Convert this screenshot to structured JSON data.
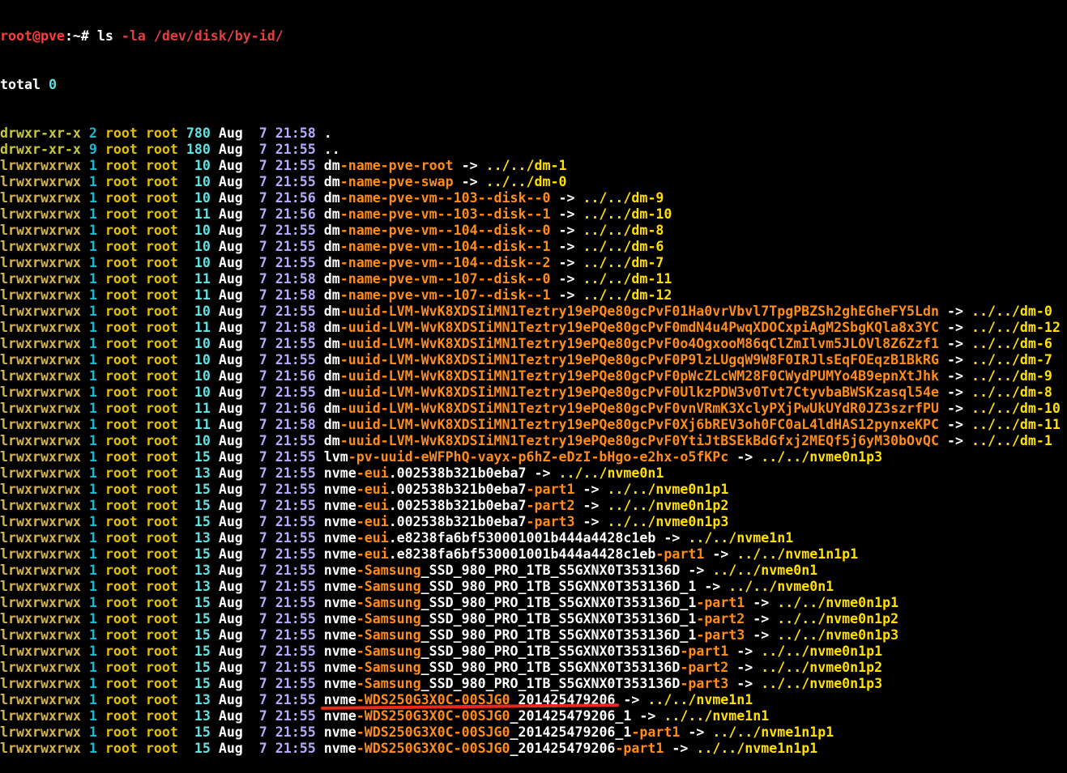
{
  "colors": {
    "background": "#000000",
    "default_text": "#ffffff",
    "prompt_user": "#ff3b3b",
    "perm_dir": "#c8c840",
    "perm_link": "#d4b44a",
    "links_count": "#22b8d0",
    "owner": "#e0c000",
    "group": "#e0c000",
    "size": "#60e0e0",
    "month": "#ffffff",
    "day": "#b8a9ff",
    "time": "#b8a9ff",
    "name_white": "#ffffff",
    "name_orange": "#ff8c1a",
    "arrow": "#ffffff",
    "target": "#ffe000",
    "annotation": "#e8271f"
  },
  "terminal": {
    "prompt": {
      "user_host": "root@pve",
      "suffix": ":~# ",
      "command": "ls",
      "args": " -la /dev/disk/by-id/"
    },
    "total_line": {
      "label": "total ",
      "value": "0"
    },
    "entries": [
      {
        "perm": "drwxr-xr-x",
        "links": "2",
        "owner": "root",
        "group": "root",
        "size": "780",
        "month": "Aug",
        "day": " 7",
        "time": "21:58",
        "name": [
          [
            "w",
            "."
          ]
        ],
        "target": ""
      },
      {
        "perm": "drwxr-xr-x",
        "links": "9",
        "owner": "root",
        "group": "root",
        "size": "180",
        "month": "Aug",
        "day": " 7",
        "time": "21:55",
        "name": [
          [
            "w",
            ".."
          ]
        ],
        "target": ""
      },
      {
        "perm": "lrwxrwxrwx",
        "links": "1",
        "owner": "root",
        "group": "root",
        "size": " 10",
        "month": "Aug",
        "day": " 7",
        "time": "21:55",
        "name": [
          [
            "w",
            "dm"
          ],
          [
            "o",
            "-name-pve-root"
          ]
        ],
        "target": "../../dm-1"
      },
      {
        "perm": "lrwxrwxrwx",
        "links": "1",
        "owner": "root",
        "group": "root",
        "size": " 10",
        "month": "Aug",
        "day": " 7",
        "time": "21:55",
        "name": [
          [
            "w",
            "dm"
          ],
          [
            "o",
            "-name-pve-swap"
          ]
        ],
        "target": "../../dm-0"
      },
      {
        "perm": "lrwxrwxrwx",
        "links": "1",
        "owner": "root",
        "group": "root",
        "size": " 10",
        "month": "Aug",
        "day": " 7",
        "time": "21:56",
        "name": [
          [
            "w",
            "dm"
          ],
          [
            "o",
            "-name-pve-vm--103--disk--0"
          ]
        ],
        "target": "../../dm-9"
      },
      {
        "perm": "lrwxrwxrwx",
        "links": "1",
        "owner": "root",
        "group": "root",
        "size": " 11",
        "month": "Aug",
        "day": " 7",
        "time": "21:56",
        "name": [
          [
            "w",
            "dm"
          ],
          [
            "o",
            "-name-pve-vm--103--disk--1"
          ]
        ],
        "target": "../../dm-10"
      },
      {
        "perm": "lrwxrwxrwx",
        "links": "1",
        "owner": "root",
        "group": "root",
        "size": " 10",
        "month": "Aug",
        "day": " 7",
        "time": "21:55",
        "name": [
          [
            "w",
            "dm"
          ],
          [
            "o",
            "-name-pve-vm--104--disk--0"
          ]
        ],
        "target": "../../dm-8"
      },
      {
        "perm": "lrwxrwxrwx",
        "links": "1",
        "owner": "root",
        "group": "root",
        "size": " 10",
        "month": "Aug",
        "day": " 7",
        "time": "21:55",
        "name": [
          [
            "w",
            "dm"
          ],
          [
            "o",
            "-name-pve-vm--104--disk--1"
          ]
        ],
        "target": "../../dm-6"
      },
      {
        "perm": "lrwxrwxrwx",
        "links": "1",
        "owner": "root",
        "group": "root",
        "size": " 10",
        "month": "Aug",
        "day": " 7",
        "time": "21:55",
        "name": [
          [
            "w",
            "dm"
          ],
          [
            "o",
            "-name-pve-vm--104--disk--2"
          ]
        ],
        "target": "../../dm-7"
      },
      {
        "perm": "lrwxrwxrwx",
        "links": "1",
        "owner": "root",
        "group": "root",
        "size": " 11",
        "month": "Aug",
        "day": " 7",
        "time": "21:58",
        "name": [
          [
            "w",
            "dm"
          ],
          [
            "o",
            "-name-pve-vm--107--disk--0"
          ]
        ],
        "target": "../../dm-11"
      },
      {
        "perm": "lrwxrwxrwx",
        "links": "1",
        "owner": "root",
        "group": "root",
        "size": " 11",
        "month": "Aug",
        "day": " 7",
        "time": "21:58",
        "name": [
          [
            "w",
            "dm"
          ],
          [
            "o",
            "-name-pve-vm--107--disk--1"
          ]
        ],
        "target": "../../dm-12"
      },
      {
        "perm": "lrwxrwxrwx",
        "links": "1",
        "owner": "root",
        "group": "root",
        "size": " 10",
        "month": "Aug",
        "day": " 7",
        "time": "21:55",
        "name": [
          [
            "w",
            "dm"
          ],
          [
            "o",
            "-uuid-LVM-WvK8XDSIiMN1Teztry19ePQe80gcPvF01Ha0vrVbvl7TpgPBZSh2ghEGheFY5Ldn"
          ]
        ],
        "target": "../../dm-0"
      },
      {
        "perm": "lrwxrwxrwx",
        "links": "1",
        "owner": "root",
        "group": "root",
        "size": " 11",
        "month": "Aug",
        "day": " 7",
        "time": "21:58",
        "name": [
          [
            "w",
            "dm"
          ],
          [
            "o",
            "-uuid-LVM-WvK8XDSIiMN1Teztry19ePQe80gcPvF0mdN4u4PwqXDOCxpiAgM2SbgKQla8x3YC"
          ]
        ],
        "target": "../../dm-12"
      },
      {
        "perm": "lrwxrwxrwx",
        "links": "1",
        "owner": "root",
        "group": "root",
        "size": " 10",
        "month": "Aug",
        "day": " 7",
        "time": "21:55",
        "name": [
          [
            "w",
            "dm"
          ],
          [
            "o",
            "-uuid-LVM-WvK8XDSIiMN1Teztry19ePQe80gcPvF0o4OgxooM86qClZmIlvm5JLOVl8Z6Zzf1"
          ]
        ],
        "target": "../../dm-6"
      },
      {
        "perm": "lrwxrwxrwx",
        "links": "1",
        "owner": "root",
        "group": "root",
        "size": " 10",
        "month": "Aug",
        "day": " 7",
        "time": "21:55",
        "name": [
          [
            "w",
            "dm"
          ],
          [
            "o",
            "-uuid-LVM-WvK8XDSIiMN1Teztry19ePQe80gcPvF0P9lzLUgqW9W8F0IRJlsEqFOEqzB1BkRG"
          ]
        ],
        "target": "../../dm-7"
      },
      {
        "perm": "lrwxrwxrwx",
        "links": "1",
        "owner": "root",
        "group": "root",
        "size": " 10",
        "month": "Aug",
        "day": " 7",
        "time": "21:56",
        "name": [
          [
            "w",
            "dm"
          ],
          [
            "o",
            "-uuid-LVM-WvK8XDSIiMN1Teztry19ePQe80gcPvF0pWcZLcWM28F0CWydPUMYo4B9epnXtJhk"
          ]
        ],
        "target": "../../dm-9"
      },
      {
        "perm": "lrwxrwxrwx",
        "links": "1",
        "owner": "root",
        "group": "root",
        "size": " 10",
        "month": "Aug",
        "day": " 7",
        "time": "21:55",
        "name": [
          [
            "w",
            "dm"
          ],
          [
            "o",
            "-uuid-LVM-WvK8XDSIiMN1Teztry19ePQe80gcPvF0UlkzPDW3v0Tvt7CtyvbaBWSKzasql54e"
          ]
        ],
        "target": "../../dm-8"
      },
      {
        "perm": "lrwxrwxrwx",
        "links": "1",
        "owner": "root",
        "group": "root",
        "size": " 11",
        "month": "Aug",
        "day": " 7",
        "time": "21:56",
        "name": [
          [
            "w",
            "dm"
          ],
          [
            "o",
            "-uuid-LVM-WvK8XDSIiMN1Teztry19ePQe80gcPvF0vnVRmK3XclyPXjPwUkUYdR0JZ3szrfPU"
          ]
        ],
        "target": "../../dm-10"
      },
      {
        "perm": "lrwxrwxrwx",
        "links": "1",
        "owner": "root",
        "group": "root",
        "size": " 11",
        "month": "Aug",
        "day": " 7",
        "time": "21:58",
        "name": [
          [
            "w",
            "dm"
          ],
          [
            "o",
            "-uuid-LVM-WvK8XDSIiMN1Teztry19ePQe80gcPvF0Xj6bREV3oh0FC0aL4ldHAS12pynxeKPC"
          ]
        ],
        "target": "../../dm-11"
      },
      {
        "perm": "lrwxrwxrwx",
        "links": "1",
        "owner": "root",
        "group": "root",
        "size": " 10",
        "month": "Aug",
        "day": " 7",
        "time": "21:55",
        "name": [
          [
            "w",
            "dm"
          ],
          [
            "o",
            "-uuid-LVM-WvK8XDSIiMN1Teztry19ePQe80gcPvF0YtiJtBSEkBdGfxj2MEQf5j6yM30bOvQC"
          ]
        ],
        "target": "../../dm-1"
      },
      {
        "perm": "lrwxrwxrwx",
        "links": "1",
        "owner": "root",
        "group": "root",
        "size": " 15",
        "month": "Aug",
        "day": " 7",
        "time": "21:55",
        "name": [
          [
            "w",
            "lvm"
          ],
          [
            "o",
            "-pv-uuid-eWFPhQ-vayx-p6hZ-eDzI-bHgo-e2hx-o5fKPc"
          ]
        ],
        "target": "../../nvme0n1p3"
      },
      {
        "perm": "lrwxrwxrwx",
        "links": "1",
        "owner": "root",
        "group": "root",
        "size": " 13",
        "month": "Aug",
        "day": " 7",
        "time": "21:55",
        "name": [
          [
            "w",
            "nvme"
          ],
          [
            "o",
            "-eui"
          ],
          [
            "w",
            ".002538b321b0eba7"
          ]
        ],
        "target": "../../nvme0n1"
      },
      {
        "perm": "lrwxrwxrwx",
        "links": "1",
        "owner": "root",
        "group": "root",
        "size": " 15",
        "month": "Aug",
        "day": " 7",
        "time": "21:55",
        "name": [
          [
            "w",
            "nvme"
          ],
          [
            "o",
            "-eui"
          ],
          [
            "w",
            ".002538b321b0eba7"
          ],
          [
            "o",
            "-part1"
          ]
        ],
        "target": "../../nvme0n1p1"
      },
      {
        "perm": "lrwxrwxrwx",
        "links": "1",
        "owner": "root",
        "group": "root",
        "size": " 15",
        "month": "Aug",
        "day": " 7",
        "time": "21:55",
        "name": [
          [
            "w",
            "nvme"
          ],
          [
            "o",
            "-eui"
          ],
          [
            "w",
            ".002538b321b0eba7"
          ],
          [
            "o",
            "-part2"
          ]
        ],
        "target": "../../nvme0n1p2"
      },
      {
        "perm": "lrwxrwxrwx",
        "links": "1",
        "owner": "root",
        "group": "root",
        "size": " 15",
        "month": "Aug",
        "day": " 7",
        "time": "21:55",
        "name": [
          [
            "w",
            "nvme"
          ],
          [
            "o",
            "-eui"
          ],
          [
            "w",
            ".002538b321b0eba7"
          ],
          [
            "o",
            "-part3"
          ]
        ],
        "target": "../../nvme0n1p3"
      },
      {
        "perm": "lrwxrwxrwx",
        "links": "1",
        "owner": "root",
        "group": "root",
        "size": " 13",
        "month": "Aug",
        "day": " 7",
        "time": "21:55",
        "name": [
          [
            "w",
            "nvme"
          ],
          [
            "o",
            "-eui"
          ],
          [
            "w",
            ".e8238fa6bf530001001b444a4428c1eb"
          ]
        ],
        "target": "../../nvme1n1"
      },
      {
        "perm": "lrwxrwxrwx",
        "links": "1",
        "owner": "root",
        "group": "root",
        "size": " 15",
        "month": "Aug",
        "day": " 7",
        "time": "21:55",
        "name": [
          [
            "w",
            "nvme"
          ],
          [
            "o",
            "-eui"
          ],
          [
            "w",
            ".e8238fa6bf530001001b444a4428c1eb"
          ],
          [
            "o",
            "-part1"
          ]
        ],
        "target": "../../nvme1n1p1"
      },
      {
        "perm": "lrwxrwxrwx",
        "links": "1",
        "owner": "root",
        "group": "root",
        "size": " 13",
        "month": "Aug",
        "day": " 7",
        "time": "21:55",
        "name": [
          [
            "w",
            "nvme"
          ],
          [
            "o",
            "-Samsung"
          ],
          [
            "w",
            "_SSD_980_PRO_1TB_S5GXNX0T353136D"
          ]
        ],
        "target": "../../nvme0n1"
      },
      {
        "perm": "lrwxrwxrwx",
        "links": "1",
        "owner": "root",
        "group": "root",
        "size": " 13",
        "month": "Aug",
        "day": " 7",
        "time": "21:55",
        "name": [
          [
            "w",
            "nvme"
          ],
          [
            "o",
            "-Samsung"
          ],
          [
            "w",
            "_SSD_980_PRO_1TB_S5GXNX0T353136D_1"
          ]
        ],
        "target": "../../nvme0n1"
      },
      {
        "perm": "lrwxrwxrwx",
        "links": "1",
        "owner": "root",
        "group": "root",
        "size": " 15",
        "month": "Aug",
        "day": " 7",
        "time": "21:55",
        "name": [
          [
            "w",
            "nvme"
          ],
          [
            "o",
            "-Samsung"
          ],
          [
            "w",
            "_SSD_980_PRO_1TB_S5GXNX0T353136D_1"
          ],
          [
            "o",
            "-part1"
          ]
        ],
        "target": "../../nvme0n1p1"
      },
      {
        "perm": "lrwxrwxrwx",
        "links": "1",
        "owner": "root",
        "group": "root",
        "size": " 15",
        "month": "Aug",
        "day": " 7",
        "time": "21:55",
        "name": [
          [
            "w",
            "nvme"
          ],
          [
            "o",
            "-Samsung"
          ],
          [
            "w",
            "_SSD_980_PRO_1TB_S5GXNX0T353136D_1"
          ],
          [
            "o",
            "-part2"
          ]
        ],
        "target": "../../nvme0n1p2"
      },
      {
        "perm": "lrwxrwxrwx",
        "links": "1",
        "owner": "root",
        "group": "root",
        "size": " 15",
        "month": "Aug",
        "day": " 7",
        "time": "21:55",
        "name": [
          [
            "w",
            "nvme"
          ],
          [
            "o",
            "-Samsung"
          ],
          [
            "w",
            "_SSD_980_PRO_1TB_S5GXNX0T353136D_1"
          ],
          [
            "o",
            "-part3"
          ]
        ],
        "target": "../../nvme0n1p3"
      },
      {
        "perm": "lrwxrwxrwx",
        "links": "1",
        "owner": "root",
        "group": "root",
        "size": " 15",
        "month": "Aug",
        "day": " 7",
        "time": "21:55",
        "name": [
          [
            "w",
            "nvme"
          ],
          [
            "o",
            "-Samsung"
          ],
          [
            "w",
            "_SSD_980_PRO_1TB_S5GXNX0T353136D"
          ],
          [
            "o",
            "-part1"
          ]
        ],
        "target": "../../nvme0n1p1"
      },
      {
        "perm": "lrwxrwxrwx",
        "links": "1",
        "owner": "root",
        "group": "root",
        "size": " 15",
        "month": "Aug",
        "day": " 7",
        "time": "21:55",
        "name": [
          [
            "w",
            "nvme"
          ],
          [
            "o",
            "-Samsung"
          ],
          [
            "w",
            "_SSD_980_PRO_1TB_S5GXNX0T353136D"
          ],
          [
            "o",
            "-part2"
          ]
        ],
        "target": "../../nvme0n1p2"
      },
      {
        "perm": "lrwxrwxrwx",
        "links": "1",
        "owner": "root",
        "group": "root",
        "size": " 15",
        "month": "Aug",
        "day": " 7",
        "time": "21:55",
        "name": [
          [
            "w",
            "nvme"
          ],
          [
            "o",
            "-Samsung"
          ],
          [
            "w",
            "_SSD_980_PRO_1TB_S5GXNX0T353136D"
          ],
          [
            "o",
            "-part3"
          ]
        ],
        "target": "../../nvme0n1p3"
      },
      {
        "perm": "lrwxrwxrwx",
        "links": "1",
        "owner": "root",
        "group": "root",
        "size": " 13",
        "month": "Aug",
        "day": " 7",
        "time": "21:55",
        "name": [
          [
            "w",
            "nvme"
          ],
          [
            "o",
            "-WDS250G3X0C-00SJG0"
          ],
          [
            "w",
            "_201425479206"
          ]
        ],
        "target": "../../nvme1n1",
        "highlighted": true
      },
      {
        "perm": "lrwxrwxrwx",
        "links": "1",
        "owner": "root",
        "group": "root",
        "size": " 13",
        "month": "Aug",
        "day": " 7",
        "time": "21:55",
        "name": [
          [
            "w",
            "nvme"
          ],
          [
            "o",
            "-WDS250G3X0C-00SJG0"
          ],
          [
            "w",
            "_201425479206_1"
          ]
        ],
        "target": "../../nvme1n1"
      },
      {
        "perm": "lrwxrwxrwx",
        "links": "1",
        "owner": "root",
        "group": "root",
        "size": " 15",
        "month": "Aug",
        "day": " 7",
        "time": "21:55",
        "name": [
          [
            "w",
            "nvme"
          ],
          [
            "o",
            "-WDS250G3X0C-00SJG0"
          ],
          [
            "w",
            "_201425479206_1"
          ],
          [
            "o",
            "-part1"
          ]
        ],
        "target": "../../nvme1n1p1"
      },
      {
        "perm": "lrwxrwxrwx",
        "links": "1",
        "owner": "root",
        "group": "root",
        "size": " 15",
        "month": "Aug",
        "day": " 7",
        "time": "21:55",
        "name": [
          [
            "w",
            "nvme"
          ],
          [
            "o",
            "-WDS250G3X0C-00SJG0"
          ],
          [
            "w",
            "_201425479206"
          ],
          [
            "o",
            "-part1"
          ]
        ],
        "target": "../../nvme1n1p1"
      }
    ],
    "arrow": " -> "
  }
}
